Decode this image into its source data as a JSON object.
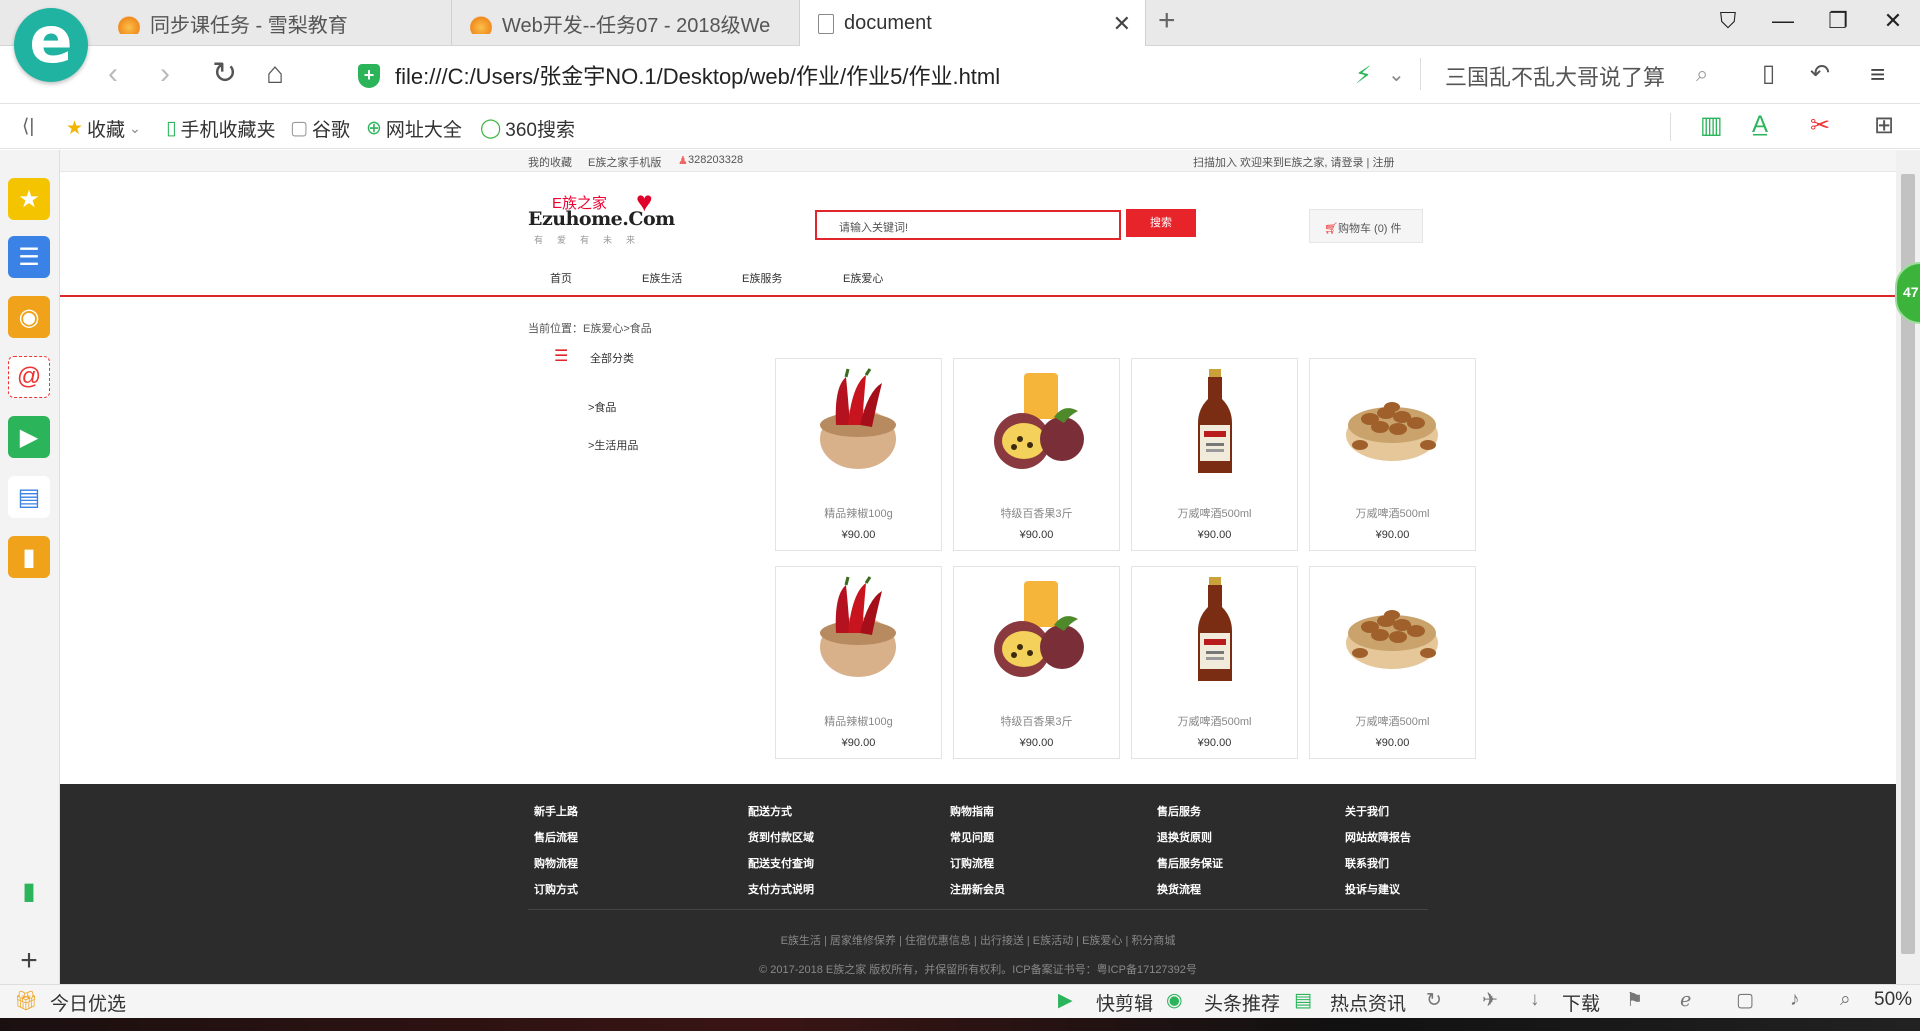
{
  "browser": {
    "tabs": [
      {
        "title": "同步课任务 - 雪梨教育",
        "icon": "flame-icon"
      },
      {
        "title": "Web开发--任务07 - 2018级We",
        "icon": "flame-icon"
      },
      {
        "title": "document",
        "icon": "document-icon",
        "active": true
      }
    ],
    "url": "file:///C:/Users/张金宇NO.1/Desktop/web/作业/作业5/作业.html",
    "search_text": "三国乱不乱大哥说了算",
    "bookmarks": [
      "收藏",
      "手机收藏夹",
      "谷歌",
      "网址大全",
      "360搜索"
    ],
    "status": {
      "left": "今日优选",
      "items": [
        "快剪辑",
        "头条推荐",
        "热点资讯",
        "下载"
      ],
      "zoom": "50%"
    },
    "float_badge": "47"
  },
  "site": {
    "topbar": {
      "left": [
        "我的收藏",
        "E族之家手机版",
        "328203328"
      ],
      "right": "扫描加入  欢迎来到E族之家,  请登录 | 注册"
    },
    "logo": {
      "line1": "E族之家",
      "line2": "Ezuhome.Com",
      "line3": "有爱有未来"
    },
    "search": {
      "placeholder": "请输入关键词!",
      "button": "搜索"
    },
    "cart": "购物车 (0) 件",
    "menu": [
      "首页",
      "E族生活",
      "E族服务",
      "E族爱心"
    ],
    "breadcrumb": "当前位置：E族爱心>食品",
    "categories": {
      "title": "全部分类",
      "items": [
        ">食品",
        ">生活用品"
      ]
    },
    "products": [
      {
        "name": "精品辣椒100g",
        "price": "¥90.00",
        "kind": "chili"
      },
      {
        "name": "特级百香果3斤",
        "price": "¥90.00",
        "kind": "passionfruit"
      },
      {
        "name": "万威啤酒500ml",
        "price": "¥90.00",
        "kind": "beer"
      },
      {
        "name": "万威啤酒500ml",
        "price": "¥90.00",
        "kind": "nuts"
      },
      {
        "name": "精品辣椒100g",
        "price": "¥90.00",
        "kind": "chili"
      },
      {
        "name": "特级百香果3斤",
        "price": "¥90.00",
        "kind": "passionfruit"
      },
      {
        "name": "万威啤酒500ml",
        "price": "¥90.00",
        "kind": "beer"
      },
      {
        "name": "万威啤酒500ml",
        "price": "¥90.00",
        "kind": "nuts"
      }
    ],
    "footer": {
      "columns": [
        [
          "新手上路",
          "售后流程",
          "购物流程",
          "订购方式"
        ],
        [
          "配送方式",
          "货到付款区域",
          "配送支付查询",
          "支付方式说明"
        ],
        [
          "购物指南",
          "常见问题",
          "订购流程",
          "注册新会员"
        ],
        [
          "售后服务",
          "退换货原则",
          "售后服务保证",
          "换货流程"
        ],
        [
          "关于我们",
          "网站故障报告",
          "联系我们",
          "投诉与建议"
        ]
      ],
      "links": "E族生活  |  居家维修保养  |  住宿优惠信息  |  出行接送  |  E族活动  |  E族爱心  |  积分商城",
      "copyright": "© 2017-2018 E族之家 版权所有，并保留所有权利。ICP备案证书号：粤ICP备17127392号"
    }
  }
}
